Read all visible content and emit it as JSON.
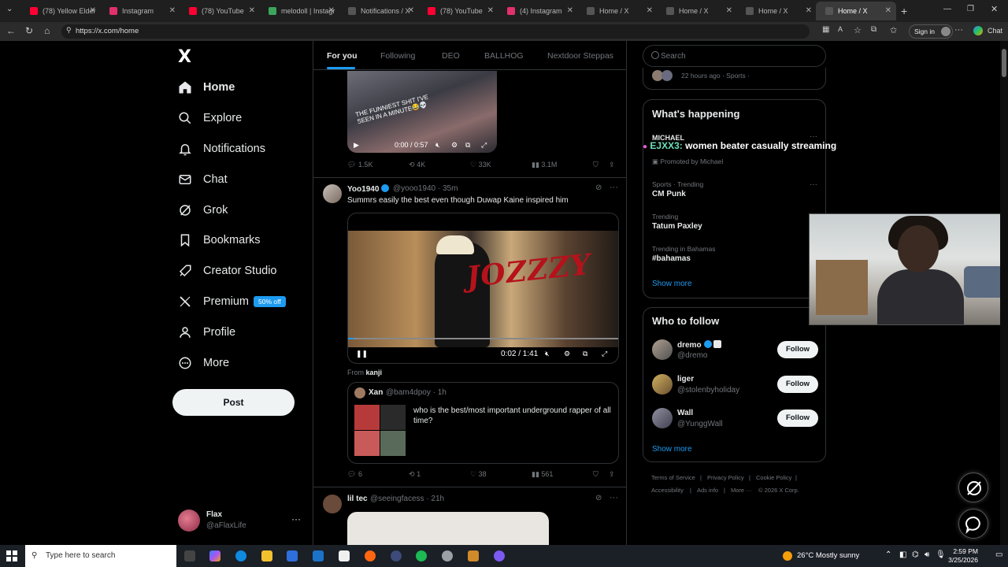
{
  "browser": {
    "tabs": [
      {
        "label": "(78) Yellow Elder",
        "color": "#ff0033"
      },
      {
        "label": "Instagram",
        "color": "#e1306c"
      },
      {
        "label": "(78) YouTube",
        "color": "#ff0033"
      },
      {
        "label": "melodoll | Instagr",
        "color": "#3ba55c"
      },
      {
        "label": "Notifications / X",
        "color": "#ffffff"
      },
      {
        "label": "(78) YouTube",
        "color": "#ff0033"
      },
      {
        "label": "(4) Instagram",
        "color": "#e1306c"
      },
      {
        "label": "Home / X",
        "color": "#ffffff"
      },
      {
        "label": "Home / X",
        "color": "#ffffff"
      },
      {
        "label": "Home / X",
        "color": "#ffffff"
      },
      {
        "label": "Home / X",
        "color": "#ffffff"
      }
    ],
    "url": "https://x.com/home",
    "signin_label": "Sign in",
    "chat_label": "Chat"
  },
  "sidebar": {
    "logo": "X",
    "items": [
      {
        "label": "Home",
        "icon": "home-icon"
      },
      {
        "label": "Explore",
        "icon": "search-icon"
      },
      {
        "label": "Notifications",
        "icon": "bell-icon"
      },
      {
        "label": "Chat",
        "icon": "mail-icon"
      },
      {
        "label": "Grok",
        "icon": "grok-icon"
      },
      {
        "label": "Bookmarks",
        "icon": "bookmark-icon"
      },
      {
        "label": "Creator Studio",
        "icon": "rocket-icon"
      },
      {
        "label": "Premium",
        "icon": "x-icon"
      },
      {
        "label": "Profile",
        "icon": "person-icon"
      },
      {
        "label": "More",
        "icon": "more-circle-icon"
      }
    ],
    "premium_badge": "50% off",
    "post_label": "Post",
    "user": {
      "name": "Flax",
      "handle": "@aFlaxLife",
      "more": "···"
    }
  },
  "feed": {
    "tabs": [
      "For you",
      "Following",
      "DEO",
      "BALLHOG",
      "Nextdoor Steppas"
    ],
    "post1": {
      "video_text": "THE FUNNIEST SHIT I'VE SEEN IN A MINUTE😂💀",
      "time": "0:00 / 0:57",
      "replies": "1.5K",
      "reposts": "4K",
      "likes": "33K",
      "views": "3.1M"
    },
    "post2": {
      "name": "Yoo1940",
      "handle": "@yooo1940",
      "time": "· 35m",
      "text": "Summrs easily the best even though Duwap Kaine inspired him",
      "video_overlay": "JOZZZY",
      "video_time": "0:02 / 1:41",
      "progress": 0.02,
      "from_label": "From",
      "from_user": "kanji",
      "quote": {
        "name": "Xan",
        "handle": "@bam4dpoy",
        "time": "· 1h",
        "text": "who is the best/most important underground rapper of all time?"
      },
      "replies": "6",
      "reposts": "1",
      "likes": "38",
      "views": "561"
    },
    "post3": {
      "name": "lil tec",
      "handle": "@seeingfacess",
      "time": "· 21h"
    }
  },
  "right": {
    "search_placeholder": "Search",
    "top_meta": "22 hours ago · Sports ·",
    "happening_title": "What's happening",
    "promoted": {
      "name": "MICHAEL",
      "label": "Promoted by Michael"
    },
    "trends": [
      {
        "category": "Sports · Trending",
        "name": "CM Punk"
      },
      {
        "category": "Trending",
        "name": "Tatum Paxley"
      },
      {
        "category": "Trending in Bahamas",
        "name": "#bahamas"
      }
    ],
    "show_more": "Show more",
    "who_title": "Who to follow",
    "follow": [
      {
        "name": "dremo",
        "handle": "@dremo"
      },
      {
        "name": "liger",
        "handle": "@stolenbyholiday"
      },
      {
        "name": "Wall",
        "handle": "@YunggWall"
      }
    ],
    "follow_label": "Follow",
    "footer": [
      "Terms of Service",
      "|",
      "Privacy Policy",
      "|",
      "Cookie Policy",
      "|",
      "Accessibility",
      "|",
      "Ads info",
      "|",
      "More ···",
      "© 2026 X Corp."
    ]
  },
  "overlay": {
    "chat_user": "EJXX3:",
    "chat_text": "women beater casually streaming"
  },
  "taskbar": {
    "search_placeholder": "Type here to search",
    "weather": "26°C  Mostly sunny",
    "time": "2:59 PM",
    "date": "3/25/2026"
  }
}
